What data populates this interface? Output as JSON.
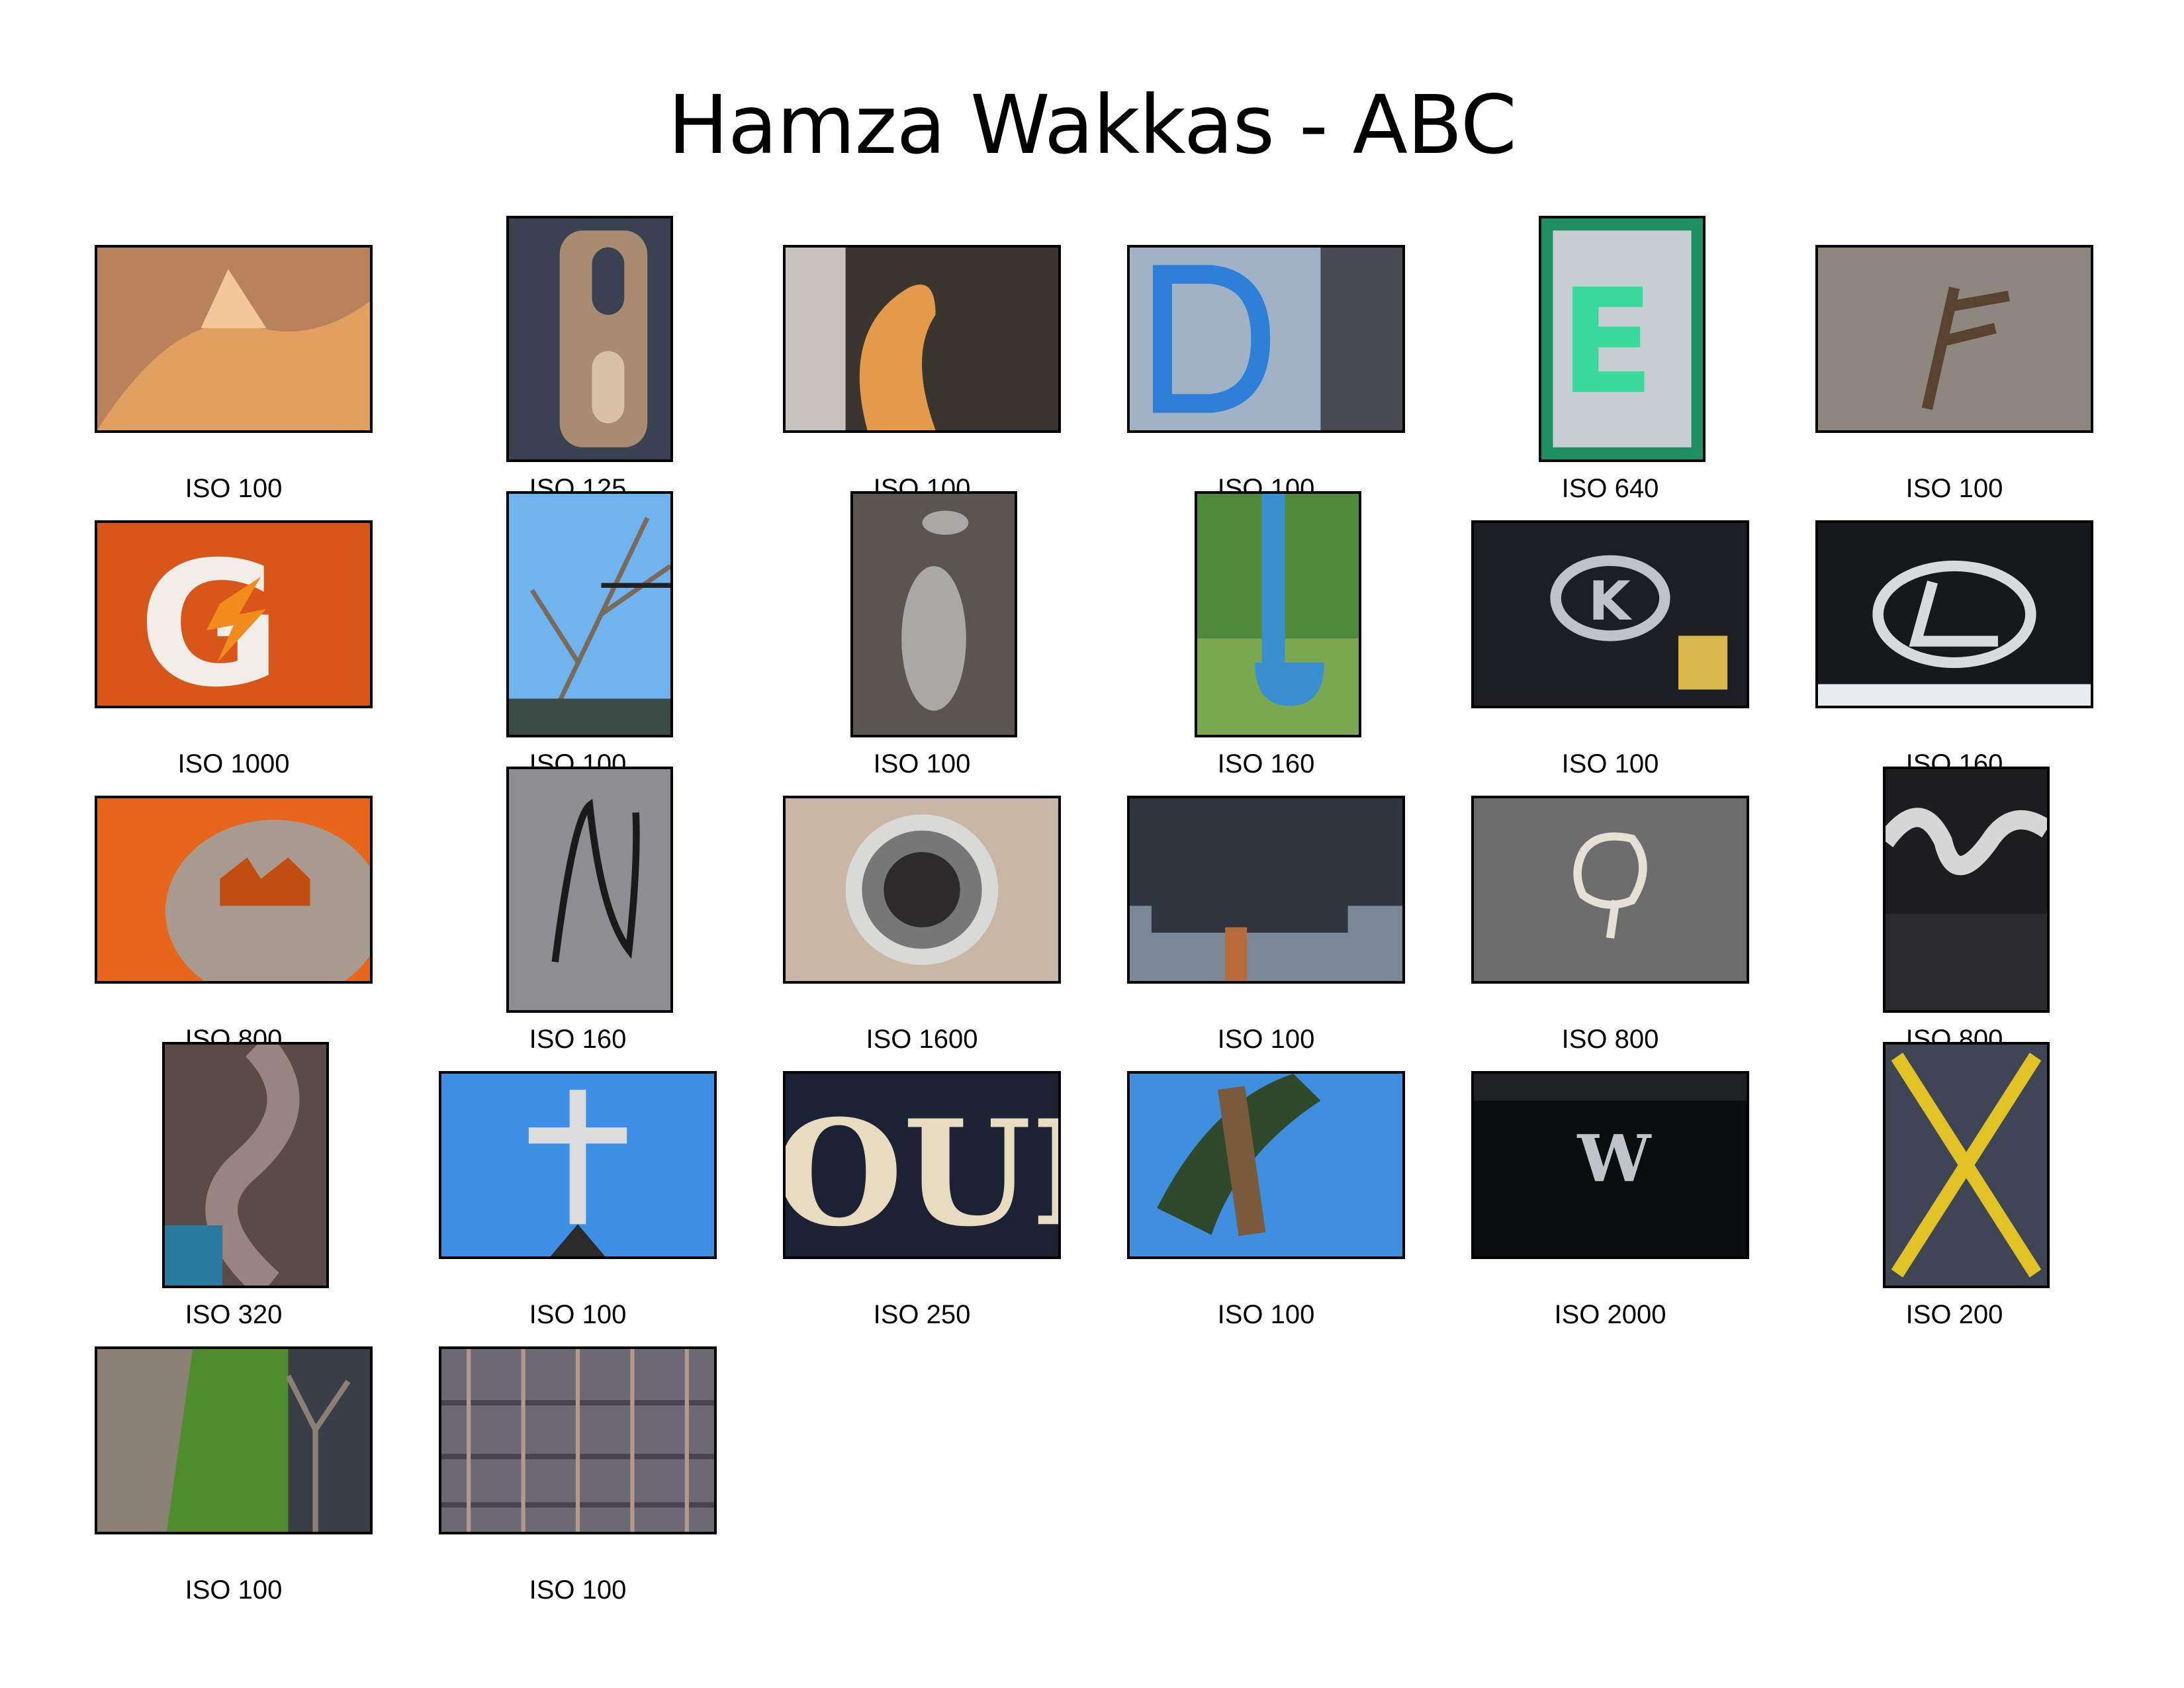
{
  "title": "Hamza Wakkas - ABC",
  "photos": [
    {
      "caption": "ISO 100",
      "subject": "cat-ear",
      "orientation": "landscape",
      "colors": [
        "#b9825a",
        "#e0a060",
        "#f3c79a"
      ]
    },
    {
      "caption": "ISO 125",
      "subject": "door-handle",
      "orientation": "portrait",
      "colors": [
        "#3a4150",
        "#a88c72",
        "#d8c1a5"
      ]
    },
    {
      "caption": "ISO 100",
      "subject": "cat-tail",
      "orientation": "landscape",
      "colors": [
        "#3b3530",
        "#e39a4a",
        "#c9c4bf"
      ]
    },
    {
      "caption": "ISO 100",
      "subject": "painted-d",
      "orientation": "landscape",
      "colors": [
        "#9fb2c6",
        "#2e7fd8",
        "#4a4b52"
      ]
    },
    {
      "caption": "ISO 640",
      "subject": "exit-sign",
      "orientation": "portrait",
      "colors": [
        "#1d8f63",
        "#38d99b",
        "#c7ced1"
      ]
    },
    {
      "caption": "ISO 100",
      "subject": "twig-f",
      "orientation": "landscape",
      "colors": [
        "#8d877e",
        "#5a4230",
        "#a59f96"
      ]
    },
    {
      "caption": "ISO 1000",
      "subject": "gatorade-g",
      "orientation": "landscape",
      "colors": [
        "#d8561a",
        "#f2ede6",
        "#f28c1c"
      ]
    },
    {
      "caption": "ISO 100",
      "subject": "branch-h",
      "orientation": "portrait",
      "colors": [
        "#6fb4ee",
        "#7a6a5a",
        "#3a4b45"
      ]
    },
    {
      "caption": "ISO 100",
      "subject": "puddle-i",
      "orientation": "portrait",
      "colors": [
        "#5a5550",
        "#a9a8a6",
        "#8a3a3a"
      ]
    },
    {
      "caption": "ISO 160",
      "subject": "pipe-j",
      "orientation": "portrait",
      "colors": [
        "#4f8a3a",
        "#3a8fd2",
        "#7aa84f"
      ]
    },
    {
      "caption": "ISO 100",
      "subject": "kia-k",
      "orientation": "landscape",
      "colors": [
        "#1d1e24",
        "#bfc2c7",
        "#d8b84a"
      ]
    },
    {
      "caption": "ISO 160",
      "subject": "lexus-l",
      "orientation": "landscape",
      "colors": [
        "#16181c",
        "#d9dadc",
        "#e9edf2"
      ]
    },
    {
      "caption": "ISO 800",
      "subject": "pumpkin-m",
      "orientation": "landscape",
      "colors": [
        "#e8661c",
        "#a89a8e",
        "#c24d10"
      ]
    },
    {
      "caption": "ISO 160",
      "subject": "string-n",
      "orientation": "portrait",
      "colors": [
        "#8e8e92",
        "#1a1a1a",
        "#a7a7aa"
      ]
    },
    {
      "caption": "ISO 1600",
      "subject": "drain-o",
      "orientation": "landscape",
      "colors": [
        "#c8b7a5",
        "#2c2a2a",
        "#d9dad8"
      ]
    },
    {
      "caption": "ISO 100",
      "subject": "mailbox-p",
      "orientation": "landscape",
      "colors": [
        "#30363f",
        "#7a8796",
        "#b76a3a"
      ]
    },
    {
      "caption": "ISO 800",
      "subject": "chalk-q",
      "orientation": "landscape",
      "colors": [
        "#6d6d6d",
        "#e6e1d6",
        "#808080"
      ]
    },
    {
      "caption": "ISO 800",
      "subject": "script-r",
      "orientation": "portrait",
      "colors": [
        "#1d1d1f",
        "#d6d6d6",
        "#2b2b2e"
      ]
    },
    {
      "caption": "ISO 320",
      "subject": "slide-s",
      "orientation": "portrait",
      "colors": [
        "#5a4a48",
        "#9a8480",
        "#2a7aa0"
      ]
    },
    {
      "caption": "ISO 100",
      "subject": "cross-t",
      "orientation": "landscape",
      "colors": [
        "#3d8fe6",
        "#dcdcdc",
        "#2a2a2a"
      ]
    },
    {
      "caption": "ISO 250",
      "subject": "sign-u",
      "orientation": "landscape",
      "colors": [
        "#1b2233",
        "#e8dcc0",
        "#4a5a7a"
      ]
    },
    {
      "caption": "ISO 100",
      "subject": "branch-v",
      "orientation": "landscape",
      "colors": [
        "#3e8fe0",
        "#2e4a2a",
        "#7a5a3a"
      ]
    },
    {
      "caption": "ISO 2000",
      "subject": "emblem-w",
      "orientation": "landscape",
      "colors": [
        "#0c0d0e",
        "#bfc4c8",
        "#1f2124"
      ]
    },
    {
      "caption": "ISO 200",
      "subject": "yellow-x",
      "orientation": "portrait",
      "colors": [
        "#3e4656",
        "#e2c325",
        "#7f8ea0"
      ]
    },
    {
      "caption": "ISO 100",
      "subject": "sapling-y",
      "orientation": "landscape",
      "colors": [
        "#4f8c2e",
        "#8a8074",
        "#3a3f47"
      ]
    },
    {
      "caption": "ISO 100",
      "subject": "railing-z",
      "orientation": "landscape",
      "colors": [
        "#6d6973",
        "#b49a8e",
        "#4a4450"
      ]
    }
  ]
}
